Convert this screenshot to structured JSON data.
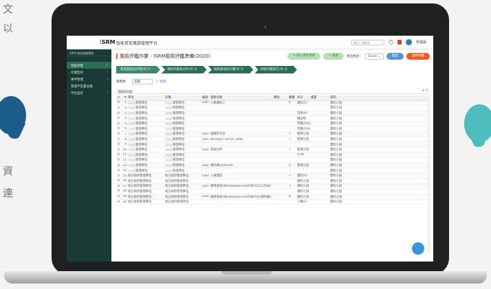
{
  "left_texts": [
    "文",
    "以",
    "資",
    "連"
  ],
  "colors": {
    "brand_green": "#1a3b35",
    "accent_orange": "#e8642c",
    "blue": "#5e93d6"
  },
  "app": {
    "logo_i": "i",
    "logo_rest": "SRM",
    "title": "智能資安風險管理平台",
    "search_placeholder": "欄位 / 選單頁",
    "username": "管理員"
  },
  "sidebar": {
    "search": "iSRM·資安風險管理",
    "items": [
      {
        "label": "風險評鑑"
      },
      {
        "label": "作業監控"
      },
      {
        "label": "事件管理"
      },
      {
        "label": "管理不定置治理"
      },
      {
        "label": "平台設定"
      }
    ]
  },
  "page": {
    "title": "風險評鑑作業 - ISRM風險評鑑準備(2020)",
    "btn1": "+ 匯入資產清單",
    "btn2": "+ 複製",
    "format_label": "匯出格式：",
    "format_value": "Excel",
    "btn_blue": "匯出",
    "btn_orange": "儲存評鑑"
  },
  "steps": [
    {
      "label": "資產盤點與評價(共 5)"
    },
    {
      "label": "風險評鑑與分析(共 3)"
    },
    {
      "label": "風險處理與計畫(共 5)"
    },
    {
      "label": "風險評鑑報告(共 3)"
    }
  ],
  "filter": {
    "label": "資產類：",
    "value": "全部",
    "add": "+ 新增"
  },
  "tab": {
    "label": "預設評估值",
    "controls": "⚙ ☰"
  },
  "table": {
    "headers": [
      "",
      "#",
      "單位",
      "名稱",
      "編號",
      "資產名稱",
      "類別",
      "數量",
      "評分",
      "權責",
      "說明"
    ],
    "rows": [
      [
        "1",
        "○○○管理單位",
        "○○○管理單位",
        "EDU-01",
        "人員資料人",
        "",
        "6",
        "資料(C)",
        "資料小說"
      ],
      [
        "2",
        "○○○管理單位",
        "○○○管理單位",
        "",
        "",
        "",
        "",
        "",
        "資料小說"
      ],
      [
        "3",
        "○○○管理單位",
        "○○○管理單位",
        "",
        "",
        "",
        "",
        "可用(A)",
        "資料小說"
      ],
      [
        "4",
        "○○○管理單位",
        "○○○管理單位",
        "",
        "",
        "",
        "",
        "機密性",
        "資料小說"
      ],
      [
        "5",
        "○○○管理單位",
        "○○○管理單位",
        "",
        "",
        "",
        "",
        "完整(CIA)",
        "資料小說"
      ],
      [
        "6",
        "○○○管理單位",
        "○○○管理單位",
        "",
        "",
        "",
        "",
        "完整(CIA)",
        "資料小說"
      ],
      [
        "7",
        "○○○管理單位",
        "○○○管理單位",
        "EDU-02",
        "組織符号台",
        "",
        "7",
        "管理小說",
        "資料小說"
      ],
      [
        "8",
        "○○○管理單位",
        "○○○管理單位",
        "EDU-03",
        "Windows Server 2008",
        "",
        "7",
        "管理小說",
        "資料小說"
      ],
      [
        "9",
        "○○○管理單位",
        "○○○管理單位",
        "",
        "",
        "",
        "",
        "",
        "資料小說"
      ],
      [
        "10",
        "○○○管理單位",
        "○○○管理單位",
        "EDU-04",
        "系統文件",
        "",
        "7",
        "管理小說",
        "資料小說"
      ],
      [
        "11",
        "○○○管理單位",
        "○○○管理單位",
        "",
        "",
        "",
        "",
        "(CIA)",
        "資料小說"
      ],
      [
        "12",
        "○○○管理單位",
        "○○○管理單位",
        "",
        "",
        "",
        "",
        "",
        "資料小說"
      ],
      [
        "13",
        "○○○管理單位",
        "○○○管理單位",
        "EDU-05",
        "資料庫(content)",
        "",
        "6",
        "管理小說",
        "資料小說"
      ],
      [
        "14",
        "○○○管理單位",
        "○○○管理單位",
        "",
        "",
        "",
        "",
        "",
        "資料小說"
      ],
      [
        "15",
        "地方政府管理單位",
        "地方政府管理單位",
        "EDU-07",
        "人員資料",
        "",
        "7",
        "資料(A)",
        "資料小說"
      ],
      [
        "16",
        "地方政府管理單位",
        "地方政府管理單位",
        "",
        "",
        "",
        "",
        "資料小說",
        "資料小說"
      ],
      [
        "17",
        "地方政府管理單位",
        "地方政府管理單位",
        "EDU-08",
        "應用系統(WindowsServer2008 R2)(工作站)",
        "",
        "7",
        "資料小說",
        "資料小說"
      ],
      [
        "18",
        "地方政府管理單位",
        "地方政府管理單位",
        "",
        "",
        "",
        "",
        "資料小說",
        "資料小說"
      ],
      [
        "19",
        "地方政府管理單位",
        "地方政府管理單位",
        "EDU-09",
        "應用系統(WindowsServer2008 R2)(資料庫)",
        "",
        "6",
        "資料小說",
        "資料小說"
      ],
      [
        "20",
        "地方政府管理單位",
        "地方政府管理單位",
        "",
        "",
        "",
        "",
        "二類(C)",
        "資料小說"
      ]
    ]
  }
}
